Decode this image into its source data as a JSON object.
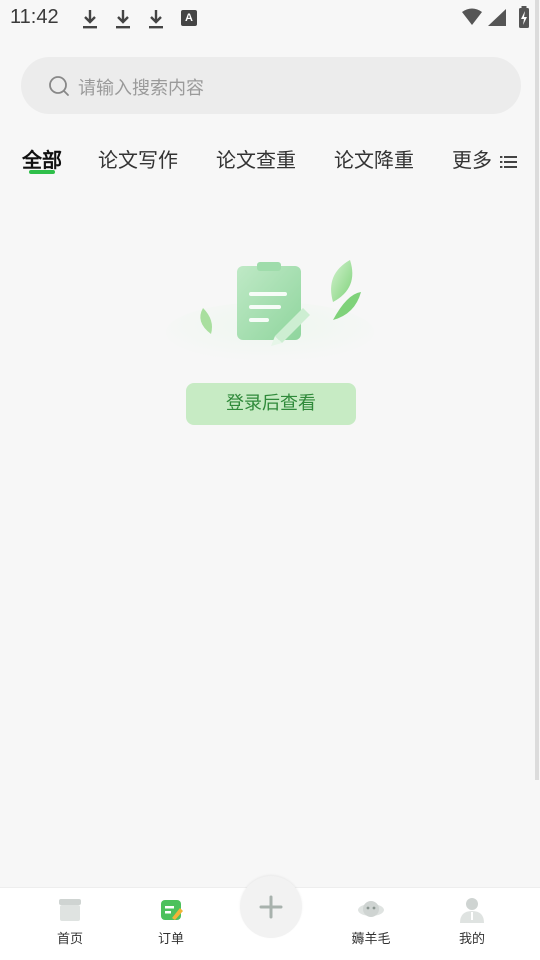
{
  "status_bar": {
    "time": "11:42",
    "notification_icons": [
      "download-icon",
      "download-icon",
      "download-icon",
      "app-a-icon"
    ],
    "app_a_letter": "A",
    "system_icons": [
      "wifi-icon",
      "signal-icon",
      "battery-charging-icon"
    ]
  },
  "search": {
    "placeholder": "请输入搜索内容"
  },
  "tabs": [
    {
      "label": "全部",
      "active": true
    },
    {
      "label": "论文写作",
      "active": false
    },
    {
      "label": "论文查重",
      "active": false
    },
    {
      "label": "论文降重",
      "active": false
    },
    {
      "label": "更多",
      "active": false
    }
  ],
  "empty_state": {
    "illustration": "clipboard-pencil-leaves",
    "button_label": "登录后查看"
  },
  "bottom_nav": {
    "items": [
      {
        "label": "首页",
        "icon": "home-box-icon"
      },
      {
        "label": "订单",
        "icon": "order-icon"
      },
      {
        "label": "",
        "icon": "add-icon"
      },
      {
        "label": "薅羊毛",
        "icon": "sheep-icon"
      },
      {
        "label": "我的",
        "icon": "user-icon"
      }
    ]
  },
  "colors": {
    "accent_green": "#2fbf4a",
    "button_bg": "#c7ebc4",
    "button_text": "#2f8a3a",
    "page_bg": "#f7f7f7"
  }
}
